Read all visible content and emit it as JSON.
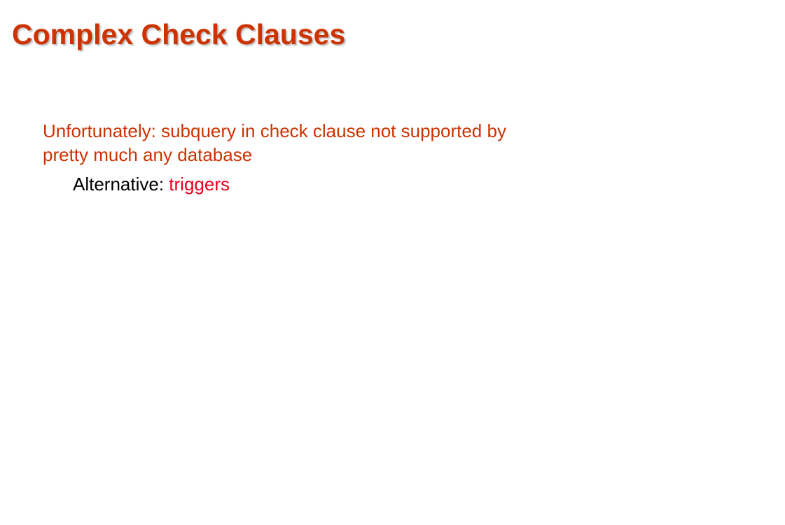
{
  "slide": {
    "title": "Complex Check Clauses",
    "bullet_1": {
      "line_1": "Unfortunately:  subquery in check clause not supported by",
      "line_2": "pretty much any database"
    },
    "bullet_2": {
      "label": "Alternative: ",
      "highlight": "triggers"
    }
  },
  "colors": {
    "title": "#cc3300",
    "bullet_1": "#cc3300",
    "bullet_2": "#000000",
    "highlight": "#e8001c",
    "background": "#ffffff"
  }
}
